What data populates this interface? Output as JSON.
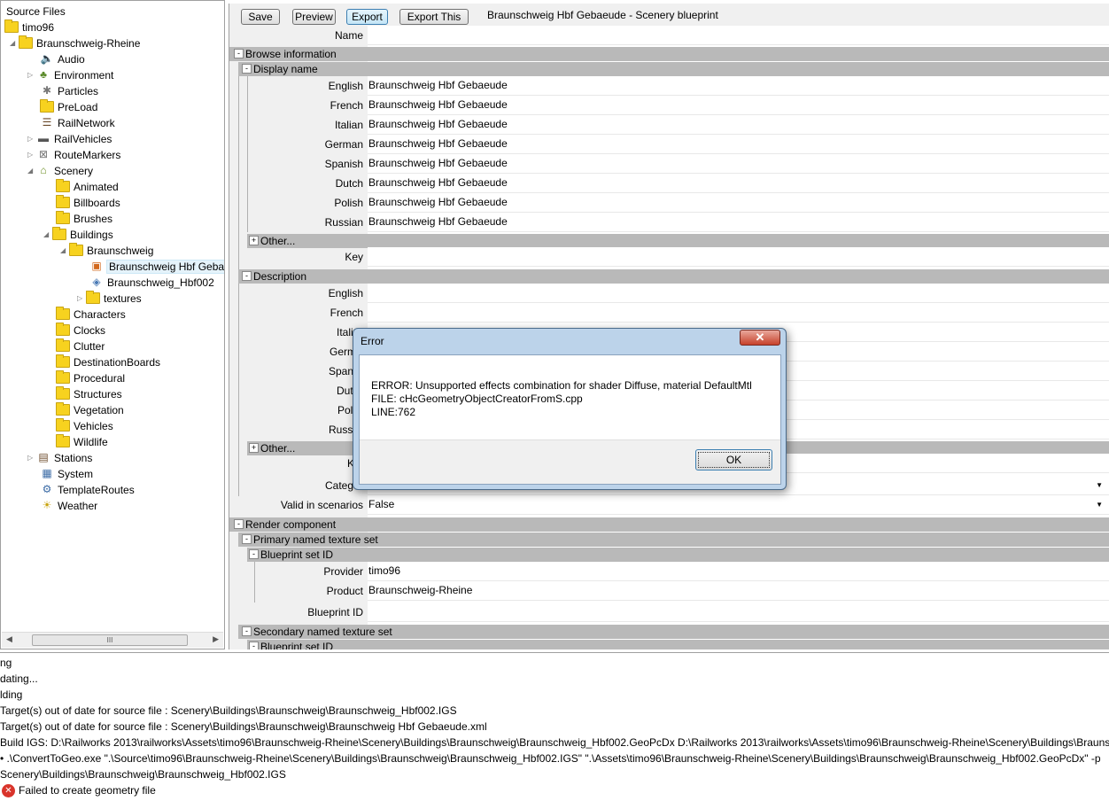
{
  "tree": {
    "title": "Source Files",
    "nodes": [
      {
        "label": "timo96",
        "icon": "folder"
      },
      {
        "label": "Braunschweig-Rheine",
        "icon": "folder"
      },
      {
        "label": "Audio",
        "icon": "speaker"
      },
      {
        "label": "Environment",
        "icon": "environment"
      },
      {
        "label": "Particles",
        "icon": "particles"
      },
      {
        "label": "PreLoad",
        "icon": "folder"
      },
      {
        "label": "RailNetwork",
        "icon": "rails"
      },
      {
        "label": "RailVehicles",
        "icon": "train"
      },
      {
        "label": "RouteMarkers",
        "icon": "markers"
      },
      {
        "label": "Scenery",
        "icon": "scenery"
      },
      {
        "label": "Animated",
        "icon": "folder"
      },
      {
        "label": "Billboards",
        "icon": "folder"
      },
      {
        "label": "Brushes",
        "icon": "folder"
      },
      {
        "label": "Buildings",
        "icon": "folder"
      },
      {
        "label": "Braunschweig",
        "icon": "folder"
      },
      {
        "label": "Braunschweig Hbf Gebae",
        "icon": "blueprint"
      },
      {
        "label": "Braunschweig_Hbf002",
        "icon": "geometry"
      },
      {
        "label": "textures",
        "icon": "folder"
      },
      {
        "label": "Characters",
        "icon": "folder"
      },
      {
        "label": "Clocks",
        "icon": "folder"
      },
      {
        "label": "Clutter",
        "icon": "folder"
      },
      {
        "label": "DestinationBoards",
        "icon": "folder"
      },
      {
        "label": "Procedural",
        "icon": "folder"
      },
      {
        "label": "Structures",
        "icon": "folder"
      },
      {
        "label": "Vegetation",
        "icon": "folder"
      },
      {
        "label": "Vehicles",
        "icon": "folder"
      },
      {
        "label": "Wildlife",
        "icon": "folder"
      },
      {
        "label": "Stations",
        "icon": "stations"
      },
      {
        "label": "System",
        "icon": "system"
      },
      {
        "label": "TemplateRoutes",
        "icon": "template"
      },
      {
        "label": "Weather",
        "icon": "weather"
      }
    ],
    "scroll_grip": "III"
  },
  "toolbar": {
    "save": "Save",
    "preview": "Preview",
    "export": "Export",
    "export_this": "Export This",
    "title": "Braunschweig Hbf Gebaeude - Scenery blueprint"
  },
  "props": {
    "name_label": "Name",
    "browse_info": "Browse information",
    "display_name": "Display name",
    "languages": [
      "English",
      "French",
      "Italian",
      "German",
      "Spanish",
      "Dutch",
      "Polish",
      "Russian"
    ],
    "display_values": [
      "Braunschweig Hbf Gebaeude",
      "Braunschweig Hbf Gebaeude",
      "Braunschweig Hbf Gebaeude",
      "Braunschweig Hbf Gebaeude",
      "Braunschweig Hbf Gebaeude",
      "Braunschweig Hbf Gebaeude",
      "Braunschweig Hbf Gebaeude",
      "Braunschweig Hbf Gebaeude"
    ],
    "other": "Other...",
    "key": "Key",
    "description": "Description",
    "desc_languages_visible": [
      "English",
      "French",
      "Itali",
      "Germ",
      "Spani",
      "Dutc",
      "Poli",
      "Russi"
    ],
    "key_cut": "K",
    "category_cut": "Categ",
    "valid_in_scenarios": "Valid in scenarios",
    "valid_value": "False",
    "render_component": "Render component",
    "primary_texture_set": "Primary named texture set",
    "blueprint_set_id": "Blueprint set ID",
    "provider": "Provider",
    "provider_value": "timo96",
    "product": "Product",
    "product_value": "Braunschweig-Rheine",
    "blueprint_id": "Blueprint ID",
    "secondary_texture_set": "Secondary named texture set",
    "blueprint_set_id_2": "Blueprint set ID"
  },
  "dialog": {
    "title": "Error",
    "close": "✕",
    "line1": "ERROR: Unsupported effects combination for shader Diffuse, material DefaultMtl",
    "line2": "FILE: cHcGeometryObjectCreatorFromS.cpp",
    "line3": "LINE:762",
    "ok": "OK"
  },
  "log": {
    "lines": [
      "ng",
      "dating...",
      "lding",
      " Target(s) out of date for source file : Scenery\\Buildings\\Braunschweig\\Braunschweig_Hbf002.IGS",
      " Target(s) out of date for source file : Scenery\\Buildings\\Braunschweig\\Braunschweig Hbf Gebaeude.xml",
      " Build IGS: D:\\Railworks 2013\\railworks\\Assets\\timo96\\Braunschweig-Rheine\\Scenery\\Buildings\\Braunschweig\\Braunschweig_Hbf002.GeoPcDx D:\\Railworks 2013\\railworks\\Assets\\timo96\\Braunschweig-Rheine\\Scenery\\Buildings\\Braunsch",
      " •  .\\ConvertToGeo.exe \".\\Source\\timo96\\Braunschweig-Rheine\\Scenery\\Buildings\\Braunschweig\\Braunschweig_Hbf002.IGS\" \".\\Assets\\timo96\\Braunschweig-Rheine\\Scenery\\Buildings\\Braunschweig\\Braunschweig_Hbf002.GeoPcDx\"  -p",
      "Scenery\\Buildings\\Braunschweig\\Braunschweig_Hbf002.IGS"
    ],
    "error_line": "Failed to create geometry file",
    "error_icon": "✕"
  },
  "colors": {
    "section_header": "#b9b9b9",
    "dialog_frame": "#bcd3ea",
    "close_button": "#c7412a",
    "folder": "#f7d21f",
    "error": "#d9342b"
  }
}
